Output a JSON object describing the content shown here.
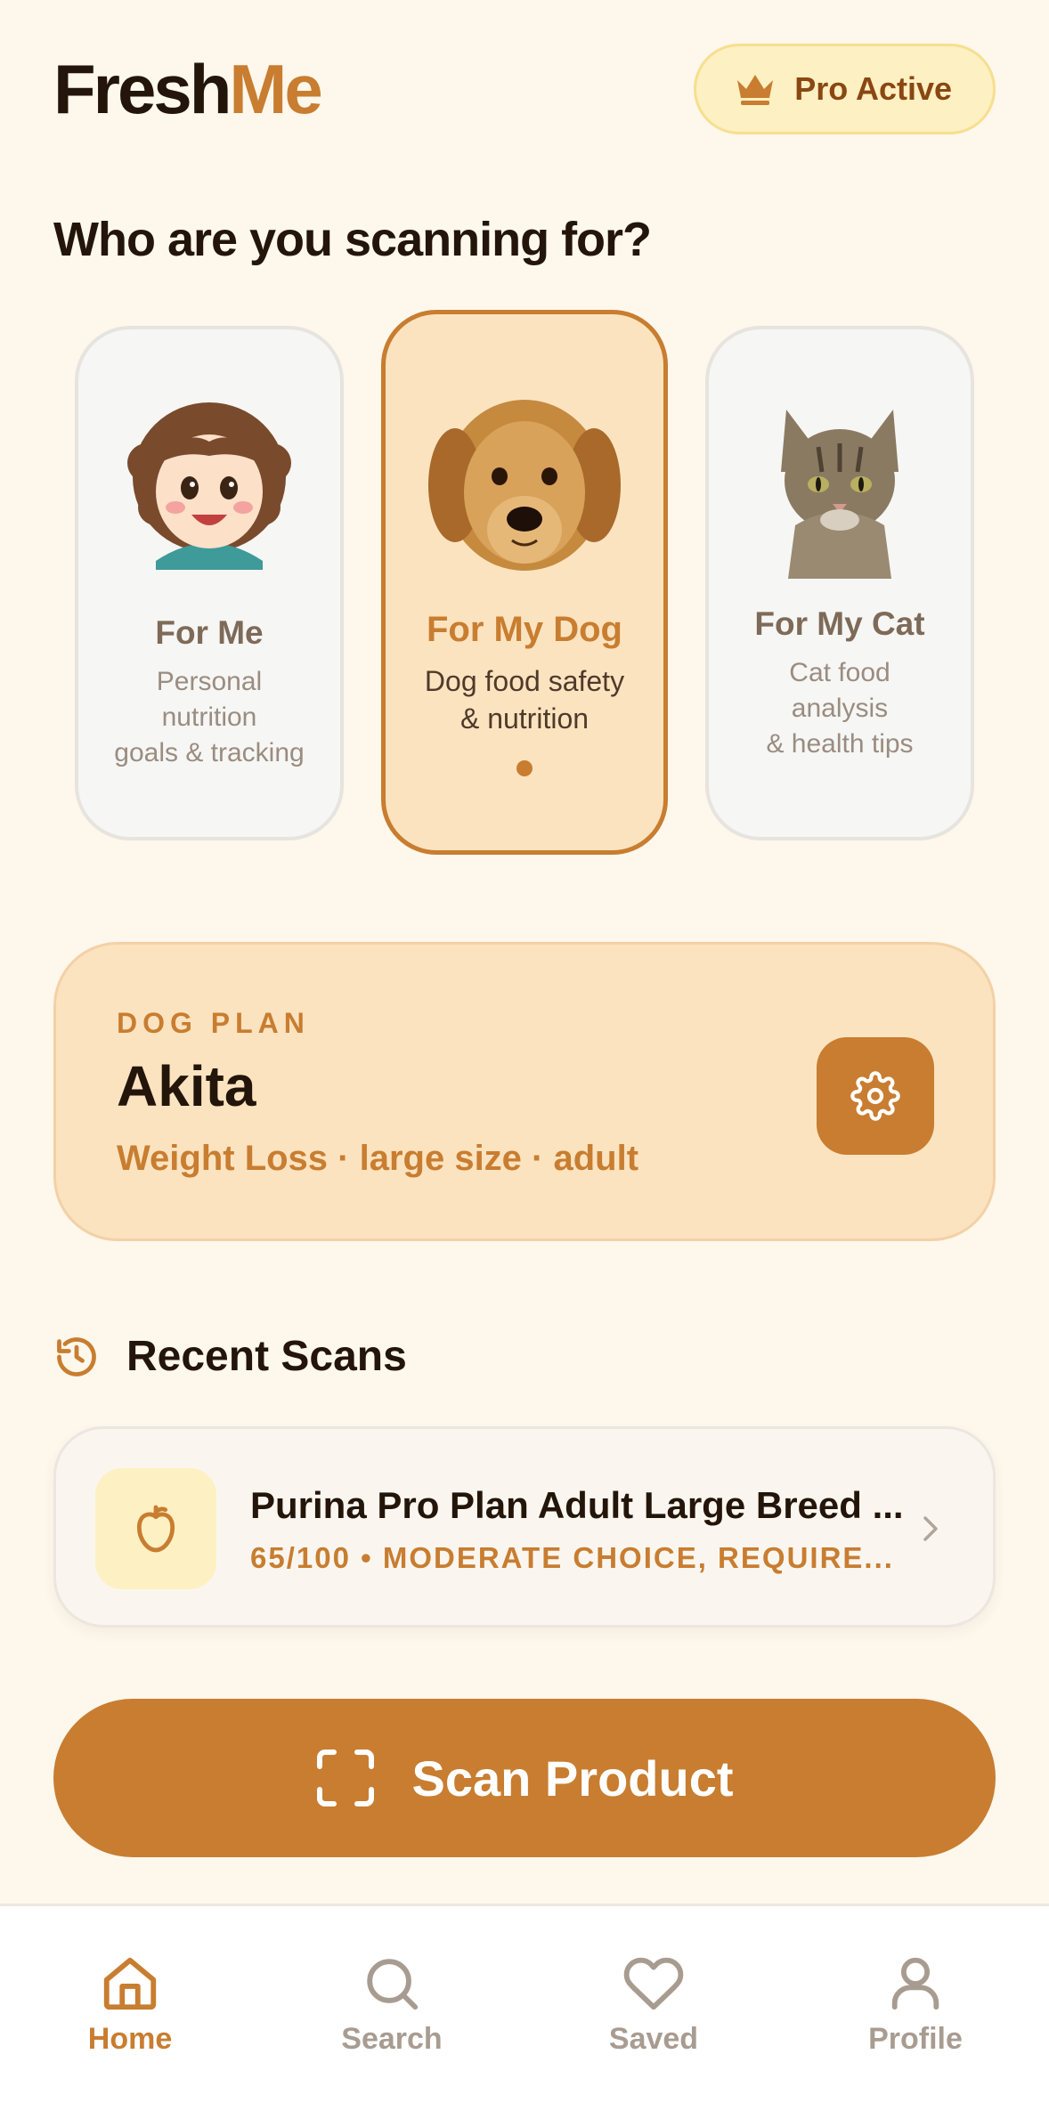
{
  "header": {
    "logo_part1": "Fresh",
    "logo_part2": "Me",
    "pro_badge": "Pro Active",
    "pro_icon": "crown-icon"
  },
  "section_title": "Who are you scanning for?",
  "profiles": [
    {
      "title": "For Me",
      "desc_lines": [
        "Personal",
        "nutrition",
        "goals & tracking"
      ],
      "image": "girl-avatar",
      "selected": false
    },
    {
      "title": "For My Dog",
      "desc_lines": [
        "Dog food safety",
        "& nutrition"
      ],
      "image": "golden-retriever-photo",
      "selected": true
    },
    {
      "title": "For My Cat",
      "desc_lines": [
        "Cat food",
        "analysis",
        "& health tips"
      ],
      "image": "tabby-cat-photo",
      "selected": false
    }
  ],
  "plan": {
    "eyebrow": "DOG PLAN",
    "name": "Akita",
    "meta": "Weight Loss · large size · adult",
    "settings_icon": "gear-icon"
  },
  "recent": {
    "title": "Recent Scans",
    "icon": "history-icon",
    "items": [
      {
        "name": "Purina Pro Plan Adult Large Breed ...",
        "score_text": "65/100 • MODERATE CHOICE, REQUIRE...",
        "icon": "apple-icon"
      }
    ]
  },
  "scan_button": {
    "label": "Scan Product",
    "icon": "scan-frame-icon"
  },
  "tabs": [
    {
      "label": "Home",
      "icon": "home-icon",
      "active": true
    },
    {
      "label": "Search",
      "icon": "search-icon",
      "active": false
    },
    {
      "label": "Saved",
      "icon": "heart-icon",
      "active": false
    },
    {
      "label": "Profile",
      "icon": "user-icon",
      "active": false
    }
  ],
  "colors": {
    "accent": "#c87d30",
    "background": "#fdf7ec",
    "card_active_bg": "#fbe3c0",
    "badge_bg": "#fdf0c2"
  }
}
